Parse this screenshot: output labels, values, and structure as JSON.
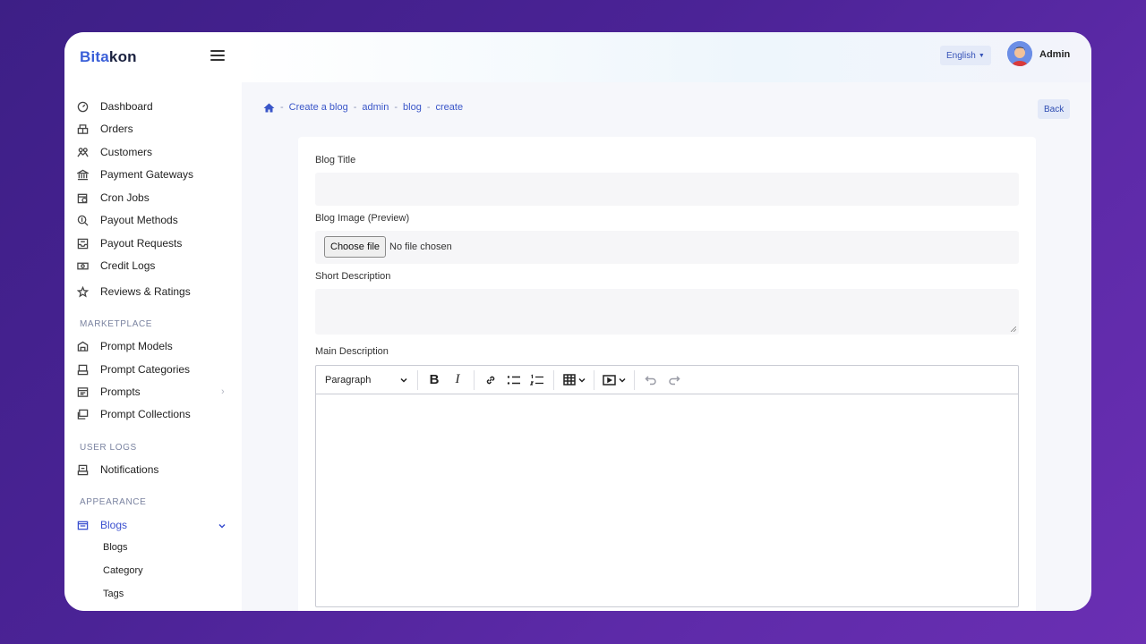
{
  "brand": {
    "part1": "Bita",
    "part2": "kon"
  },
  "sidebar": {
    "items": [
      {
        "label": "Dashboard",
        "icon": "dashboard-icon"
      },
      {
        "label": "Orders",
        "icon": "orders-icon"
      },
      {
        "label": "Customers",
        "icon": "customers-icon"
      },
      {
        "label": "Payment Gateways",
        "icon": "bank-icon"
      },
      {
        "label": "Cron Jobs",
        "icon": "calendar-clock-icon"
      },
      {
        "label": "Payout Methods",
        "icon": "search-money-icon"
      },
      {
        "label": "Payout Requests",
        "icon": "inbox-icon"
      },
      {
        "label": "Credit Logs",
        "icon": "money-icon"
      },
      {
        "label": "Reviews & Ratings",
        "icon": "star-icon"
      }
    ],
    "sections": {
      "marketplace": "MARKETPLACE",
      "user_logs": "USER LOGS",
      "appearance": "APPEARANCE"
    },
    "marketplace_items": [
      {
        "label": "Prompt Models",
        "icon": "model-icon"
      },
      {
        "label": "Prompt Categories",
        "icon": "category-icon"
      },
      {
        "label": "Prompts",
        "icon": "prompt-icon"
      },
      {
        "label": "Prompt Collections",
        "icon": "collection-icon"
      }
    ],
    "user_logs_items": [
      {
        "label": "Notifications",
        "icon": "notification-icon"
      }
    ],
    "appearance_items": [
      {
        "label": "Blogs",
        "icon": "blog-icon",
        "active": true
      }
    ],
    "blog_sub_items": [
      "Blogs",
      "Category",
      "Tags"
    ]
  },
  "header": {
    "language": "English",
    "user_name": "Admin"
  },
  "breadcrumb": [
    "Create a blog",
    "admin",
    "blog",
    "create"
  ],
  "back_label": "Back",
  "form": {
    "title_label": "Blog Title",
    "title_value": "",
    "image_label": "Blog Image (Preview)",
    "file_button": "Choose file",
    "file_status": "No file chosen",
    "short_desc_label": "Short Description",
    "short_desc_value": "",
    "main_desc_label": "Main Description",
    "editor_paragraph": "Paragraph"
  },
  "colors": {
    "accent": "#3a56c8",
    "background_gradient_start": "#3d1f86",
    "background_gradient_end": "#6a2fb3"
  }
}
